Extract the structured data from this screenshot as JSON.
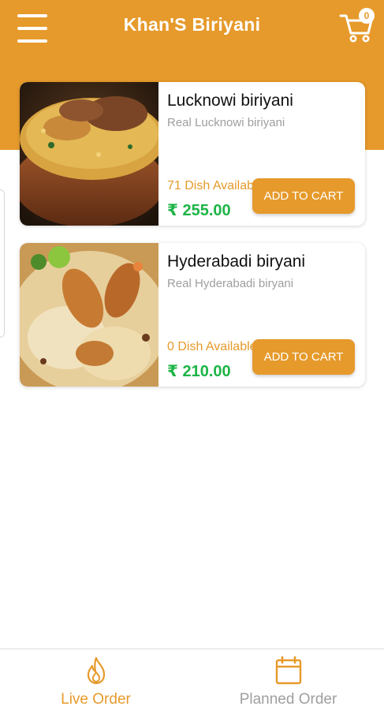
{
  "app": {
    "title": "Khan'S Biriyani",
    "cart_count": "0",
    "accent_color": "#E69A2B",
    "price_color": "#1DB446"
  },
  "header": {
    "menu_icon": "hamburger-menu-icon",
    "cart_icon": "shopping-cart-icon"
  },
  "dishes": [
    {
      "name": "Lucknowi biriyani",
      "description": "Real Lucknowi biriyani",
      "availability": "71 Dish Available",
      "price": "₹ 255.00",
      "button_label": "ADD TO CART"
    },
    {
      "name": "Hyderabadi biryani",
      "description": "Real Hyderabadi biryani",
      "availability": "0 Dish Available",
      "price": "₹ 210.00",
      "button_label": "ADD TO CART"
    }
  ],
  "bottom_nav": {
    "items": [
      {
        "label": "Live Order",
        "icon": "flame-icon",
        "active": true
      },
      {
        "label": "Planned Order",
        "icon": "calendar-icon",
        "active": false
      }
    ]
  }
}
